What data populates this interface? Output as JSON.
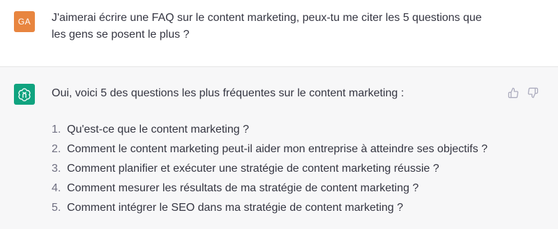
{
  "user_message": {
    "avatar_initials": "GA",
    "avatar_color": "#e8853f",
    "text": "J'aimerai écrire une FAQ sur le content marketing, peux-tu me citer les 5 questions que les gens se posent le plus ?"
  },
  "assistant_message": {
    "avatar_icon": "openai-logo-icon",
    "avatar_color": "#10a37f",
    "intro": "Oui, voici 5 des questions les plus fréquentes sur le content marketing :",
    "list": [
      {
        "num": "1.",
        "text": "Qu'est-ce que le content marketing ?"
      },
      {
        "num": "2.",
        "text": "Comment le content marketing peut-il aider mon entreprise à atteindre ses objectifs ?"
      },
      {
        "num": "3.",
        "text": "Comment planifier et exécuter une stratégie de content marketing réussie ?"
      },
      {
        "num": "4.",
        "text": "Comment mesurer les résultats de ma stratégie de content marketing ?"
      },
      {
        "num": "5.",
        "text": "Comment intégrer le SEO dans ma stratégie de content marketing ?"
      }
    ],
    "feedback_icons": [
      "thumbs-up-icon",
      "thumbs-down-icon"
    ]
  }
}
